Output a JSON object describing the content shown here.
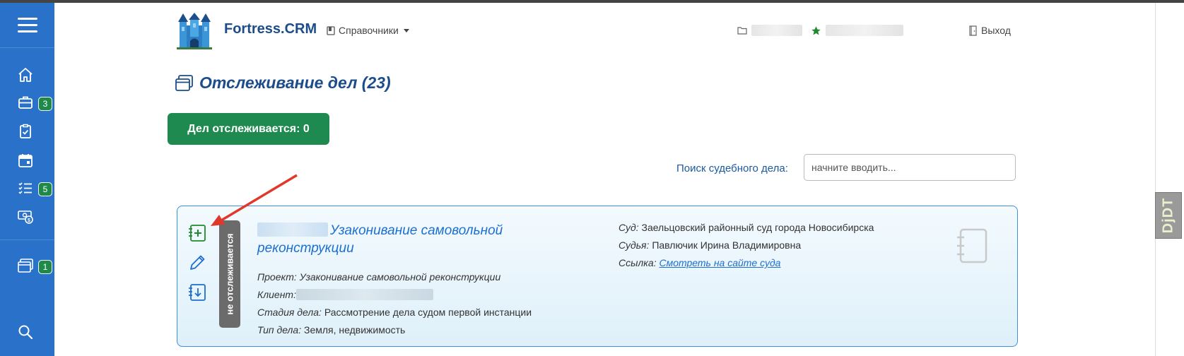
{
  "header": {
    "brand": "Fortress.CRM",
    "dictionaries_label": "Справочники",
    "logout_label": "Выход"
  },
  "sidebar": {
    "items": [
      {
        "name": "home",
        "badge": ""
      },
      {
        "name": "briefcase",
        "badge": "3"
      },
      {
        "name": "clipboard",
        "badge": ""
      },
      {
        "name": "calendar",
        "badge": ""
      },
      {
        "name": "tasks",
        "badge": "5"
      },
      {
        "name": "money",
        "badge": ""
      },
      {
        "name": "cases",
        "badge": "1"
      },
      {
        "name": "search",
        "badge": ""
      }
    ]
  },
  "page": {
    "title": "Отслеживание дел (23)",
    "tracked_button": "Дел отслеживается: 0",
    "search_label": "Поиск судебного дела:",
    "search_placeholder": "начните вводить..."
  },
  "case": {
    "status": "не отслеживается",
    "title": "Узаконивание самовольной реконструкции",
    "project_label": "Проект:",
    "project_value": "Узаконивание самовольной реконструкции",
    "client_label": "Клиент:",
    "stage_label": "Стадия дела:",
    "stage_value": "Рассмотрение дела судом первой инстанции",
    "type_label": "Тип дела:",
    "type_value": "Земля, недвижимость",
    "court_label": "Суд:",
    "court_value": "Заельцовский районный суд города Новосибирска",
    "judge_label": "Судья:",
    "judge_value": "Павлючик Ирина Владимировна",
    "link_label": "Ссылка:",
    "link_value": "Смотреть на сайте суда"
  },
  "widget": {
    "label": "DjDT"
  },
  "colors": {
    "sidebar": "#2a72c9",
    "primary_text": "#1c4d8a",
    "success": "#1f8a4f",
    "card_border": "#3d8fe0",
    "annotation_arrow": "#e0392b"
  }
}
